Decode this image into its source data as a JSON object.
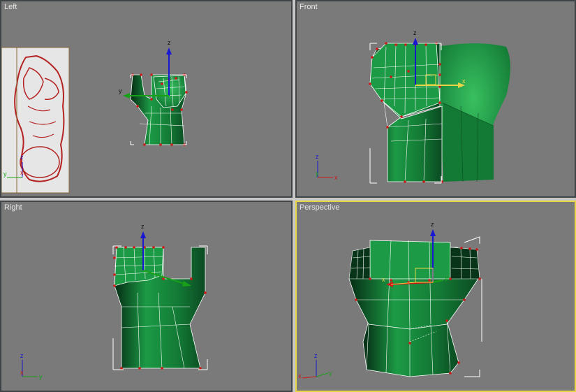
{
  "viewports": {
    "left": {
      "label": "Left"
    },
    "front": {
      "label": "Front"
    },
    "right": {
      "label": "Right"
    },
    "perspective": {
      "label": "Perspective"
    }
  },
  "axes": {
    "x": "x",
    "y": "y",
    "z": "z"
  },
  "colors": {
    "viewport_bg": "#7a7a7a",
    "active_border": "#e8d545",
    "mesh_green": "#1b8a3c",
    "mesh_dark": "#06301a",
    "wire": "#ffffff",
    "vertex": "#d01818",
    "axis_x": "#d01818",
    "axis_y": "#18a018",
    "axis_z": "#1818d0",
    "sketch_line": "#b42222",
    "sketch_bg": "#e6e6e6"
  }
}
